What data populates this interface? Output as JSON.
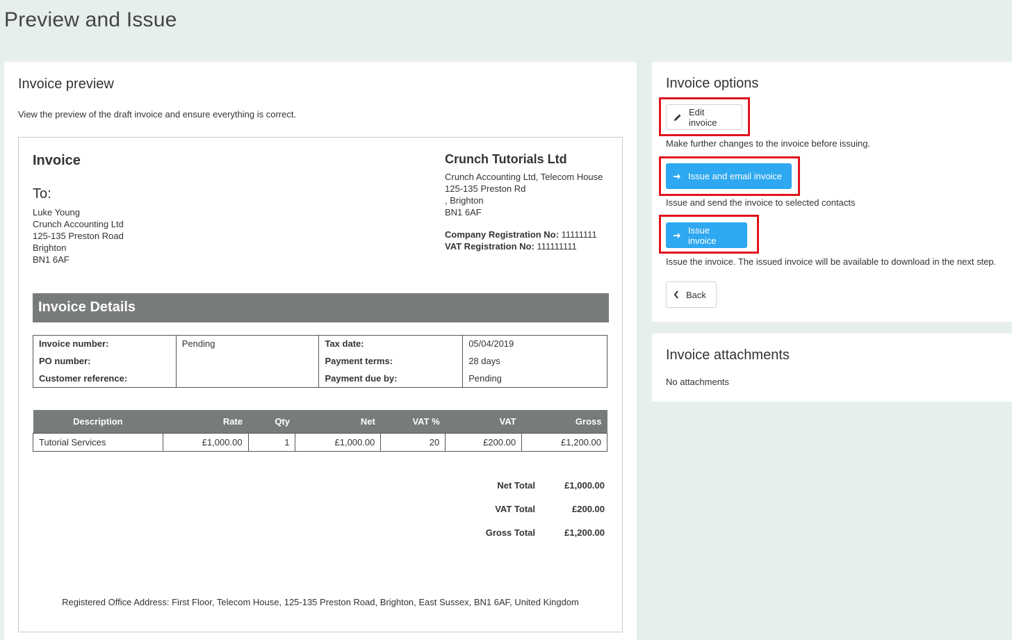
{
  "page": {
    "title": "Preview and Issue"
  },
  "preview": {
    "title": "Invoice preview",
    "description": "View the preview of the draft invoice and ensure everything is correct."
  },
  "invoice": {
    "heading": "Invoice",
    "to_label": "To:",
    "to_lines": [
      "Luke Young",
      "Crunch Accounting Ltd",
      "125-135 Preston Road",
      "Brighton",
      "BN1 6AF"
    ],
    "company_name": "Crunch Tutorials Ltd",
    "company_lines": [
      "Crunch Accounting Ltd, Telecom House",
      "125-135 Preston Rd",
      ", Brighton",
      "BN1 6AF"
    ],
    "company_reg_label": "Company Registration No:",
    "company_reg_value": "11111111",
    "vat_reg_label": "VAT Registration No:",
    "vat_reg_value": "111111111",
    "details_title": "Invoice Details",
    "meta": {
      "invoice_number_label": "Invoice number:",
      "invoice_number_value": "Pending",
      "po_number_label": "PO number:",
      "po_number_value": "",
      "customer_ref_label": "Customer reference:",
      "customer_ref_value": "",
      "tax_date_label": "Tax date:",
      "tax_date_value": "05/04/2019",
      "payment_terms_label": "Payment terms:",
      "payment_terms_value": "28 days",
      "payment_due_label": "Payment due by:",
      "payment_due_value": "Pending"
    },
    "columns": [
      "Description",
      "Rate",
      "Qty",
      "Net",
      "VAT %",
      "VAT",
      "Gross"
    ],
    "items": [
      {
        "description": "Tutorial Services",
        "rate": "£1,000.00",
        "qty": "1",
        "net": "£1,000.00",
        "vat_pct": "20",
        "vat": "£200.00",
        "gross": "£1,200.00"
      }
    ],
    "totals": {
      "net_label": "Net Total",
      "net_value": "£1,000.00",
      "vat_label": "VAT Total",
      "vat_value": "£200.00",
      "gross_label": "Gross Total",
      "gross_value": "£1,200.00"
    },
    "footer": "Registered Office Address: First Floor, Telecom House, 125-135 Preston Road, Brighton, East Sussex, BN1 6AF, United Kingdom"
  },
  "options": {
    "title": "Invoice options",
    "edit_label": "Edit invoice",
    "edit_help": "Make further changes to the invoice before issuing.",
    "issue_email_label": "Issue and email invoice",
    "issue_email_help": "Issue and send the invoice to selected contacts",
    "issue_label": "Issue invoice",
    "issue_help": "Issue the invoice. The issued invoice will be available to download in the next step.",
    "back_label": "Back"
  },
  "attachments": {
    "title": "Invoice attachments",
    "empty_text": "No attachments"
  },
  "colors": {
    "accent_blue": "#2ea8f0",
    "highlight_red": "#e0141e",
    "header_grey": "#787b7b",
    "page_bg": "#e6eeee"
  },
  "icons": {
    "edit": "pencil-icon",
    "issue": "arrow-right-icon",
    "back": "chevron-left-icon"
  }
}
